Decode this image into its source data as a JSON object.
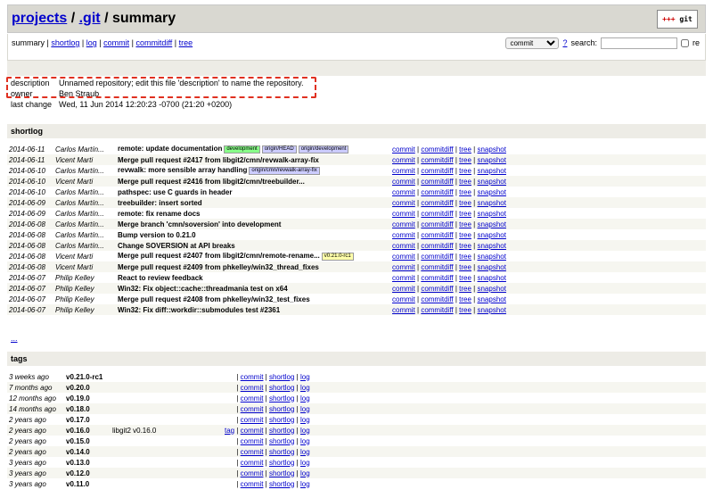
{
  "header": {
    "breadcrumb": [
      "projects",
      ".git"
    ],
    "separator": "/",
    "page": "summary",
    "logo_text": "git",
    "logo_plus": "+++"
  },
  "nav": {
    "items": [
      "summary",
      "shortlog",
      "log",
      "commit",
      "commitdiff",
      "tree"
    ],
    "sep": "|"
  },
  "search": {
    "select_value": "commit",
    "help": "?",
    "label": "search:",
    "value": "",
    "regex_label": "re"
  },
  "project": {
    "description_label": "description",
    "description": "Unnamed repository; edit this file 'description' to name the repository.",
    "owner_label": "owner",
    "owner": "Ben Straub",
    "last_change_label": "last change",
    "last_change": "Wed, 11 Jun 2014 12:20:23 -0700 (21:20 +0200)"
  },
  "shortlog": {
    "title": "shortlog",
    "link_labels": [
      "commit",
      "commitdiff",
      "tree",
      "snapshot"
    ],
    "more": "...",
    "rows": [
      {
        "date": "2014-06-11",
        "author": "Carlos Martín...",
        "subject": "remote: update documentation",
        "refs": [
          {
            "t": "development",
            "k": "dev"
          },
          {
            "t": "origin/HEAD",
            "k": "remote"
          },
          {
            "t": "origin/development",
            "k": "remote"
          }
        ]
      },
      {
        "date": "2014-06-11",
        "author": "Vicent Marti",
        "subject": "Merge pull request #2417 from libgit2/cmn/revwalk-array-fix",
        "refs": []
      },
      {
        "date": "2014-06-10",
        "author": "Carlos Martín...",
        "subject": "revwalk: more sensible array handling",
        "refs": [
          {
            "t": "origin/cmn/revwalk-array-fix",
            "k": "remote"
          }
        ]
      },
      {
        "date": "2014-06-10",
        "author": "Vicent Marti",
        "subject": "Merge pull request #2416 from libgit2/cmn/treebuilder...",
        "refs": []
      },
      {
        "date": "2014-06-10",
        "author": "Carlos Martín...",
        "subject": "pathspec: use C guards in header",
        "refs": []
      },
      {
        "date": "2014-06-09",
        "author": "Carlos Martín...",
        "subject": "treebuilder: insert sorted",
        "refs": []
      },
      {
        "date": "2014-06-09",
        "author": "Carlos Martín...",
        "subject": "remote: fix rename docs",
        "refs": []
      },
      {
        "date": "2014-06-08",
        "author": "Carlos Martín...",
        "subject": "Merge branch 'cmn/soversion' into development",
        "refs": []
      },
      {
        "date": "2014-06-08",
        "author": "Carlos Martín...",
        "subject": "Bump version to 0.21.0",
        "refs": []
      },
      {
        "date": "2014-06-08",
        "author": "Carlos Martín...",
        "subject": "Change SOVERSION at API breaks",
        "refs": []
      },
      {
        "date": "2014-06-08",
        "author": "Vicent Marti",
        "subject": "Merge pull request #2407 from libgit2/cmn/remote-rename...",
        "refs": [
          {
            "t": "v0.21.0-rc1",
            "k": "tag"
          }
        ]
      },
      {
        "date": "2014-06-08",
        "author": "Vicent Marti",
        "subject": "Merge pull request #2409 from phkelley/win32_thread_fixes",
        "refs": []
      },
      {
        "date": "2014-06-07",
        "author": "Philip Kelley",
        "subject": "React to review feedback",
        "refs": []
      },
      {
        "date": "2014-06-07",
        "author": "Philip Kelley",
        "subject": "Win32: Fix object::cache::threadmania test on x64",
        "refs": []
      },
      {
        "date": "2014-06-07",
        "author": "Philip Kelley",
        "subject": "Merge pull request #2408 from phkelley/win32_test_fixes",
        "refs": []
      },
      {
        "date": "2014-06-07",
        "author": "Philip Kelley",
        "subject": "Win32: Fix diff::workdir::submodules test #2361",
        "refs": []
      }
    ]
  },
  "tags": {
    "title": "tags",
    "tag_link": "tag",
    "link_labels": [
      "commit",
      "shortlog",
      "log"
    ],
    "rows": [
      {
        "age": "3 weeks ago",
        "name": "v0.21.0-rc1",
        "desc": "",
        "has_tag": false
      },
      {
        "age": "7 months ago",
        "name": "v0.20.0",
        "desc": "",
        "has_tag": false
      },
      {
        "age": "12 months ago",
        "name": "v0.19.0",
        "desc": "",
        "has_tag": false
      },
      {
        "age": "14 months ago",
        "name": "v0.18.0",
        "desc": "",
        "has_tag": false
      },
      {
        "age": "2 years ago",
        "name": "v0.17.0",
        "desc": "",
        "has_tag": false
      },
      {
        "age": "2 years ago",
        "name": "v0.16.0",
        "desc": "libgit2 v0.16.0",
        "has_tag": true
      },
      {
        "age": "2 years ago",
        "name": "v0.15.0",
        "desc": "",
        "has_tag": false
      },
      {
        "age": "2 years ago",
        "name": "v0.14.0",
        "desc": "",
        "has_tag": false
      },
      {
        "age": "3 years ago",
        "name": "v0.13.0",
        "desc": "",
        "has_tag": false
      },
      {
        "age": "3 years ago",
        "name": "v0.12.0",
        "desc": "",
        "has_tag": false
      },
      {
        "age": "3 years ago",
        "name": "v0.11.0",
        "desc": "",
        "has_tag": false
      }
    ]
  }
}
